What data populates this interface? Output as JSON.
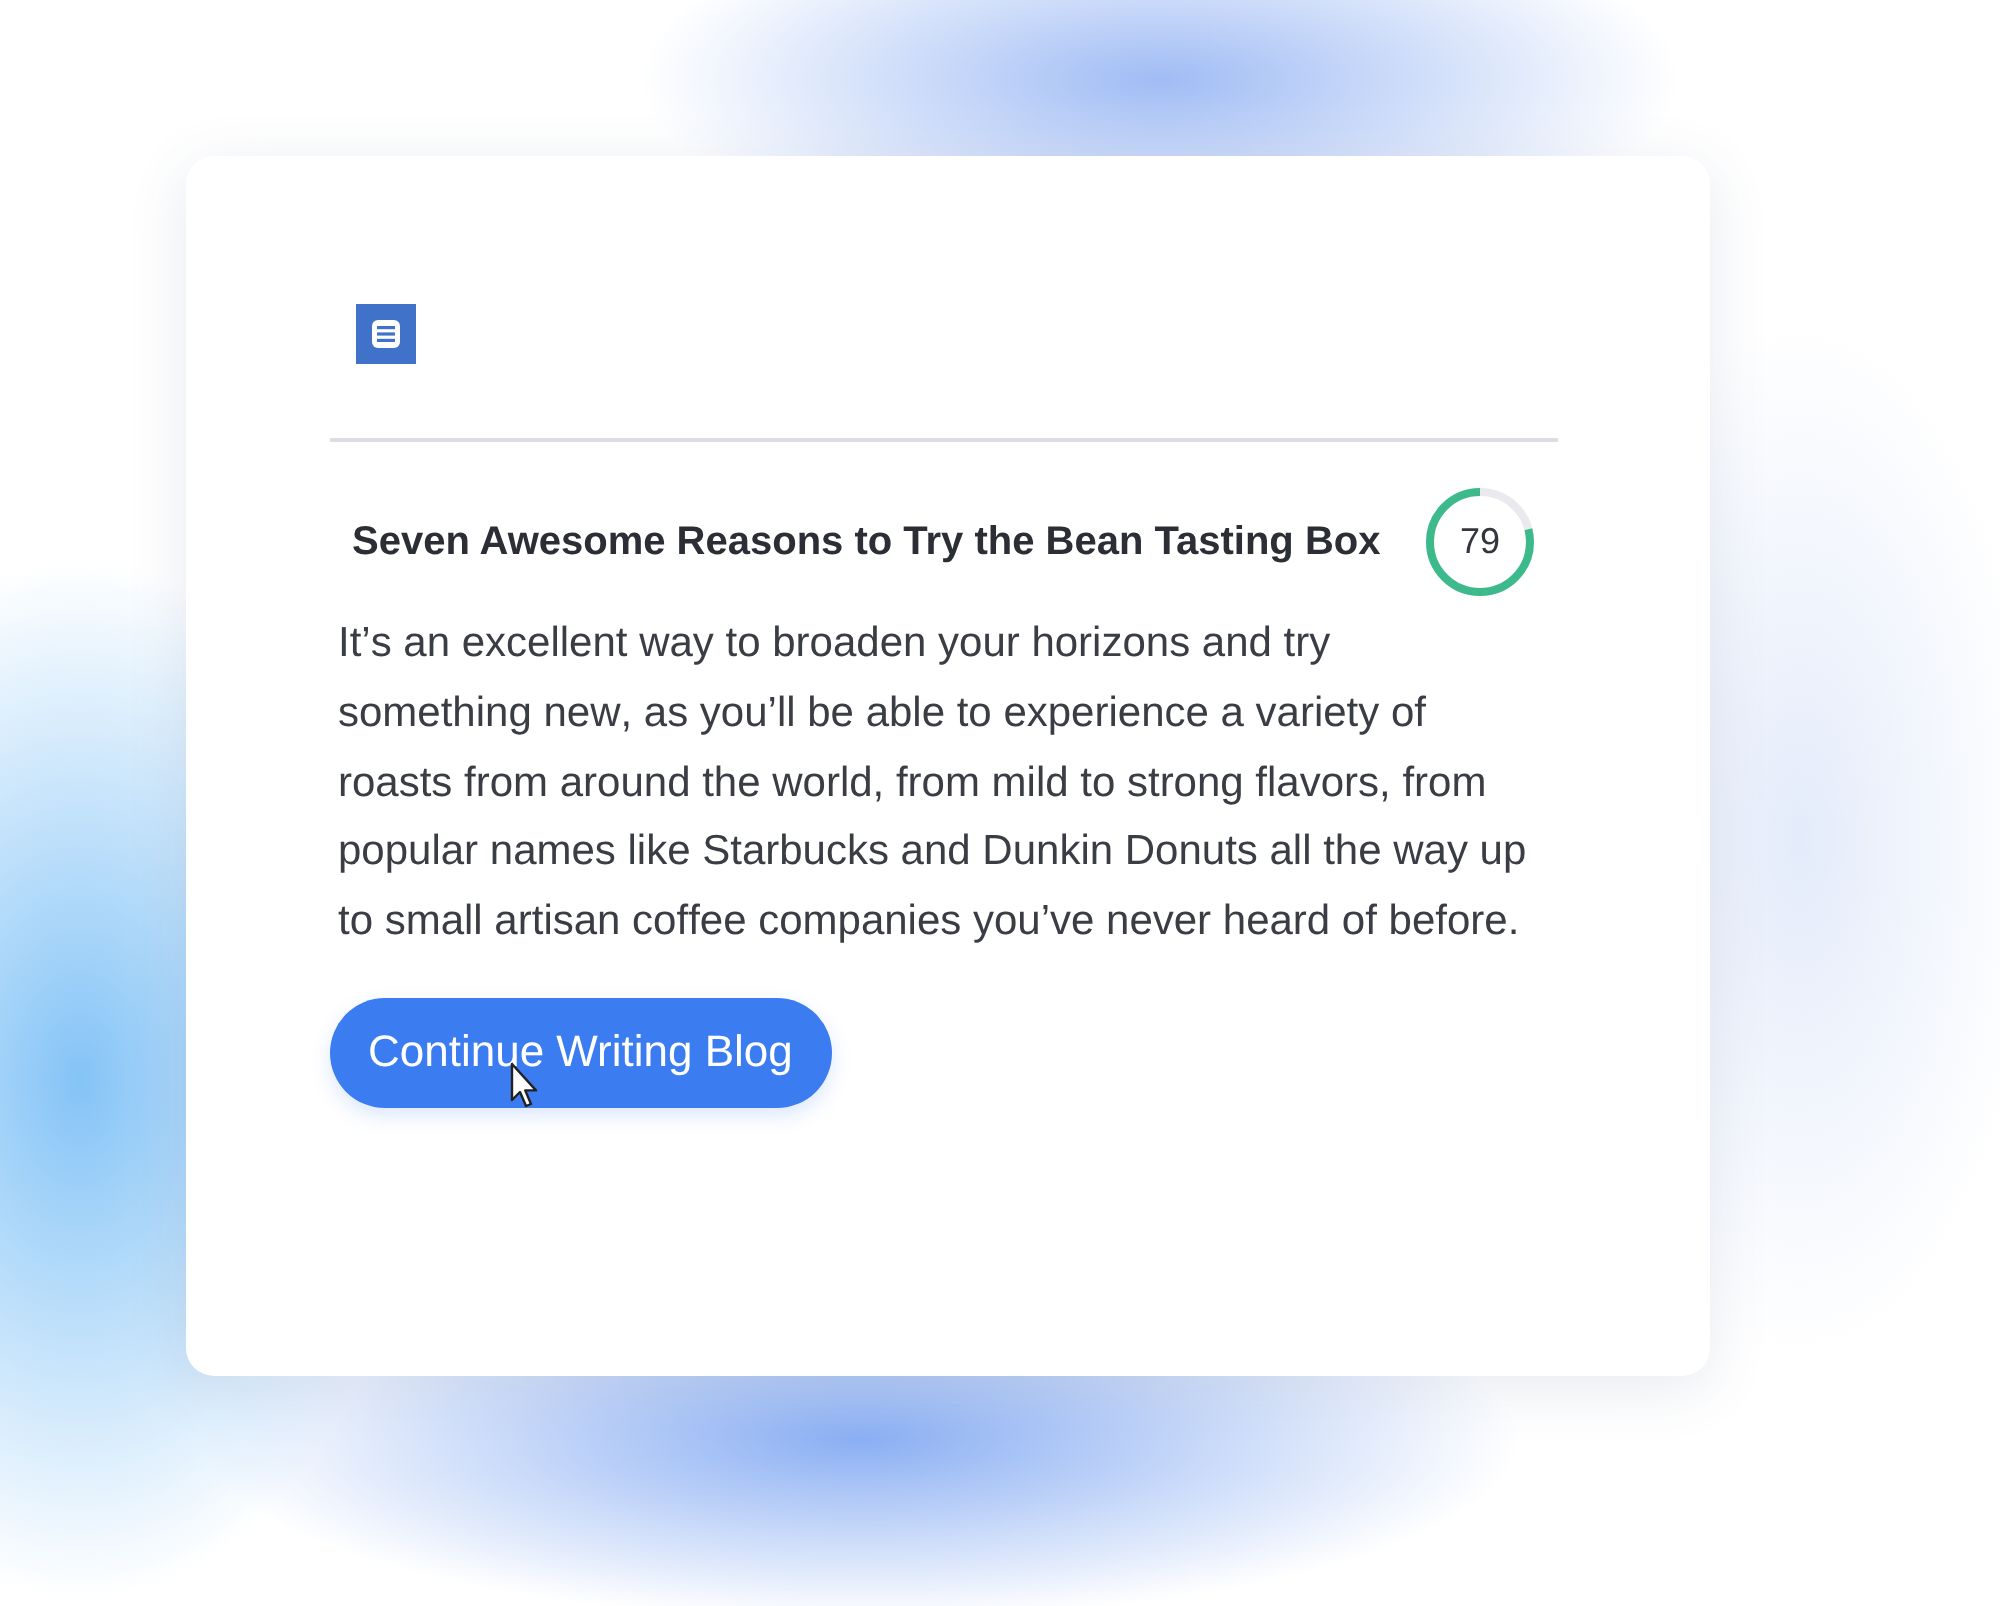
{
  "card": {
    "title": "Seven Awesome Reasons to Try the Bean Tasting Box",
    "score": {
      "value": "79",
      "level": 0.79
    },
    "body": "It’s an excellent way to broaden your horizons and try something new, as you’ll be able to experience a variety of roasts from around the world, from mild to strong flavors, from popular names like Starbucks and Dunkin Donuts all the way up to small artisan coffee companies you’ve never heard of before.",
    "button": {
      "label": "Continue Writing Blog"
    }
  }
}
